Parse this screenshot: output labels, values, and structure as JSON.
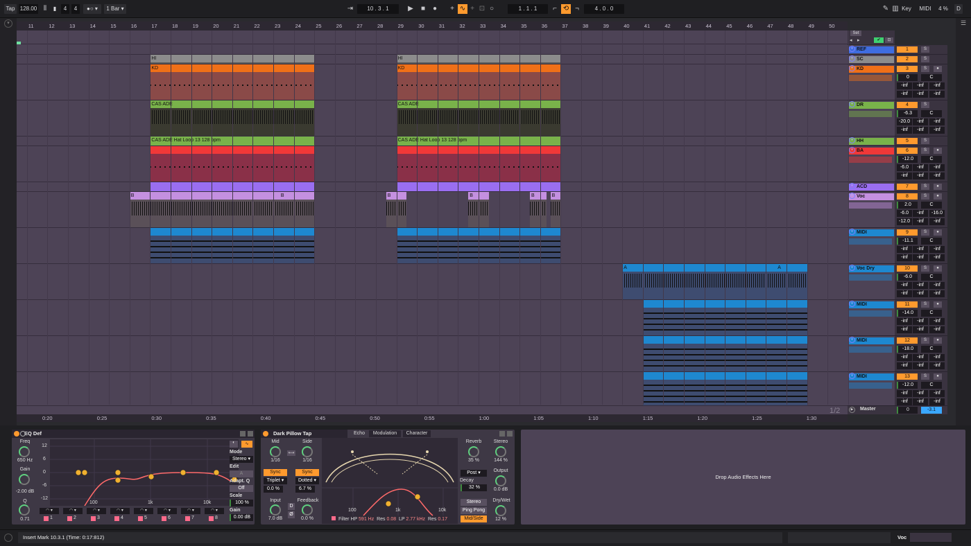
{
  "topbar": {
    "tap": "Tap",
    "tempo": "128.00",
    "time_sig_num": "4",
    "time_sig_den": "4",
    "metro": "1 Bar",
    "position": "10 .  3 .  1",
    "loop_start": "1 .  1 .  1",
    "loop_length": "4 .  0 .  0",
    "key": "Key",
    "midi": "MIDI",
    "cpu": "4 %",
    "d": "D"
  },
  "ruler": {
    "bars": [
      "11",
      "12",
      "13",
      "14",
      "15",
      "16",
      "17",
      "18",
      "19",
      "20",
      "21",
      "22",
      "23",
      "24",
      "25",
      "26",
      "27",
      "28",
      "29",
      "30",
      "31",
      "32",
      "33",
      "34",
      "35",
      "36",
      "37",
      "38",
      "39",
      "40",
      "41",
      "42",
      "43",
      "44",
      "45",
      "46",
      "47",
      "48",
      "49",
      "50"
    ],
    "set": "Set",
    "times": [
      "0:20",
      "0:25",
      "0:30",
      "0:35",
      "0:40",
      "0:45",
      "0:50",
      "0:55",
      "1:00",
      "1:05",
      "1:10",
      "1:15",
      "1:20",
      "1:25",
      "1:30"
    ],
    "page": "1/2"
  },
  "tracks": [
    {
      "name": "REF",
      "num": "1",
      "color": "#3f6de0",
      "s": "S",
      "vol": "",
      "pan": ""
    },
    {
      "name": "SC",
      "num": "2",
      "color": "#8c8c8c",
      "s": "S",
      "vol": "",
      "pan": ""
    },
    {
      "name": "KD",
      "num": "3",
      "color": "#f07018",
      "s": "S",
      "vol": "0",
      "pan": "C",
      "s1": "-inf",
      "s2": "-inf",
      "s3": "-inf",
      "s4": "-inf",
      "s5": "-inf",
      "s6": "-inf"
    },
    {
      "name": "DR",
      "num": "4",
      "color": "#79b24a",
      "s": "S",
      "vol": "-6.3",
      "pan": "C",
      "s1": "-20.0",
      "s2": "-inf",
      "s3": "-inf",
      "s4": "-inf",
      "s5": "-inf",
      "s6": "-inf"
    },
    {
      "name": "HH",
      "num": "5",
      "color": "#79b24a",
      "s": "S"
    },
    {
      "name": "BA",
      "num": "6",
      "color": "#f03838",
      "s": "S",
      "vol": "-12.0",
      "pan": "C",
      "s1": "-6.0",
      "s2": "-inf",
      "s3": "-inf",
      "s4": "-inf",
      "s5": "-inf",
      "s6": "-inf"
    },
    {
      "name": "ACD",
      "num": "7",
      "color": "#9a6ef0",
      "s": "S"
    },
    {
      "name": "Voc",
      "num": "8",
      "color": "#c490e0",
      "s": "S",
      "vol": "2.0",
      "pan": "C",
      "s1": "-6.0",
      "s2": "-inf",
      "s3": "-16.0",
      "s4": "-12.0",
      "s5": "-inf",
      "s6": "-inf"
    },
    {
      "name": "MIDI",
      "num": "9",
      "color": "#1e88d0",
      "s": "S",
      "vol": "-11.1",
      "pan": "C",
      "s1": "-inf",
      "s2": "-inf",
      "s3": "-inf",
      "s4": "-inf",
      "s5": "-inf",
      "s6": "-inf"
    },
    {
      "name": "Voc Dry",
      "num": "10",
      "color": "#1e88d0",
      "s": "S",
      "vol": "-6.0",
      "pan": "C",
      "s1": "-inf",
      "s2": "-inf",
      "s3": "-inf",
      "s4": "-inf",
      "s5": "-inf",
      "s6": "-inf"
    },
    {
      "name": "MIDI",
      "num": "11",
      "color": "#1e88d0",
      "s": "S",
      "vol": "-14.0",
      "pan": "C",
      "s1": "-inf",
      "s2": "-inf",
      "s3": "-inf",
      "s4": "-inf",
      "s5": "-inf",
      "s6": "-inf"
    },
    {
      "name": "MIDI",
      "num": "12",
      "color": "#1e88d0",
      "s": "S",
      "vol": "-18.0",
      "pan": "C",
      "s1": "-inf",
      "s2": "-inf",
      "s3": "-inf",
      "s4": "-inf",
      "s5": "-inf",
      "s6": "-inf"
    },
    {
      "name": "MIDI",
      "num": "13",
      "color": "#1e88d0",
      "s": "S",
      "vol": "-12.0",
      "pan": "C",
      "s1": "-inf",
      "s2": "-inf",
      "s3": "-inf",
      "s4": "-inf",
      "s5": "-inf",
      "s6": "-inf"
    }
  ],
  "master": {
    "name": "Master",
    "vol": "0",
    "pan": "-3.1"
  },
  "clips": {
    "hi": "HI",
    "kd": "KD",
    "cas": "CAS ADE",
    "hat_loop": "CAS ADE Hat Loop 13 128 bpm",
    "b": "B",
    "a": "A"
  },
  "eq": {
    "title": "EQ Def",
    "freq_label": "Freq",
    "freq": "650 Hz",
    "gain_label": "Gain",
    "gain": "-2.00 dB",
    "q_label": "Q",
    "q": "0.71",
    "db_ticks": [
      "12",
      "6",
      "0",
      "-6",
      "-12"
    ],
    "hz_ticks": [
      "100",
      "1k",
      "10k"
    ],
    "mode_label": "Mode",
    "mode": "Stereo",
    "edit_label": "Edit",
    "edit": "A",
    "adaptq_label": "Adapt. Q",
    "adaptq": "Off",
    "scale_label": "Scale",
    "scale": "100 %",
    "gain2_label": "Gain",
    "gain2": "0.00 dB",
    "bands": [
      "1",
      "2",
      "3",
      "4",
      "5",
      "6",
      "7",
      "8"
    ]
  },
  "delay": {
    "title": "Dark Pillow Tap",
    "tabs": [
      "Echo",
      "Modulation",
      "Character"
    ],
    "mid": "Mid",
    "side": "Side",
    "mid_val": "1/16",
    "side_val": "1/16",
    "sync": "Sync",
    "triplet": "Triplet",
    "dotted": "Dotted",
    "mid_offset": "0.0 %",
    "side_offset": "6.7 %",
    "input_label": "Input",
    "input": "7.0 dB",
    "feedback_label": "Feedback",
    "feedback": "0.0 %",
    "d": "D",
    "ø": "Ø",
    "reverb_label": "Reverb",
    "reverb": "35 %",
    "stereo_label": "Stereo",
    "stereo": "144 %",
    "post": "Post",
    "decay_label": "Decay",
    "decay": "32 %",
    "output_label": "Output",
    "output": "0.0 dB",
    "drywet_label": "Dry/Wet",
    "drywet": "12 %",
    "stereo_btn": "Stereo",
    "pingpong": "Ping Pong",
    "midside": "Mid/Side",
    "filter": "Filter",
    "hp": "HP",
    "hp_val": "591 Hz",
    "res_label": "Res",
    "res1": "0.08",
    "lp": "LP",
    "lp_val": "2.77 kHz",
    "res2": "0.17",
    "hz_ticks": [
      "100",
      "1k",
      "10k"
    ]
  },
  "drop": "Drop Audio Effects Here",
  "status": {
    "text": "Insert Mark 10.3.1 (Time: 0:17:812)",
    "track": "Voc"
  }
}
